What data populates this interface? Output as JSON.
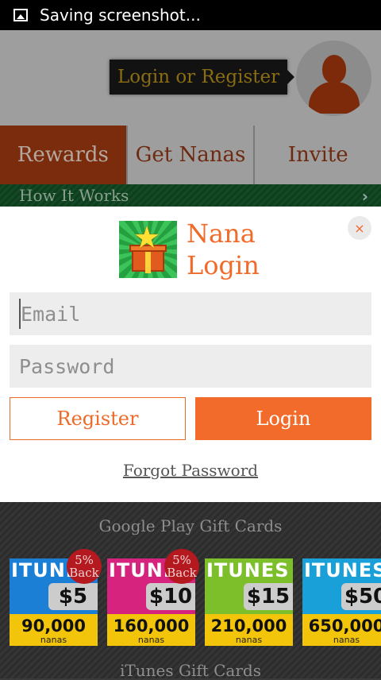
{
  "status_bar": {
    "text": "Saving screenshot...",
    "icon": "image-icon"
  },
  "header": {
    "login_tip": "Login or Register",
    "avatar_icon": "user-icon"
  },
  "tabs": [
    {
      "label": "Rewards",
      "active": true
    },
    {
      "label": "Get Nanas",
      "active": false
    },
    {
      "label": "Invite",
      "active": false
    }
  ],
  "how_it_works": {
    "label": "How It Works"
  },
  "login_modal": {
    "title_line1": "Nana",
    "title_line2": "Login",
    "close_symbol": "×",
    "email_placeholder": "Email",
    "password_placeholder": "Password",
    "register_label": "Register",
    "login_label": "Login",
    "forgot_label": "Forgot Password"
  },
  "sections": {
    "google_play": "Google Play Gift Cards",
    "itunes": "iTunes Gift Cards"
  },
  "cards": [
    {
      "brand": "ITUNES",
      "amount": "$5",
      "nanas": "90,000",
      "unit": "nanas",
      "badge_line1": "5%",
      "badge_line2": "Back",
      "color": "#1c7fd6"
    },
    {
      "brand": "ITUNES",
      "amount": "$10",
      "nanas": "160,000",
      "unit": "nanas",
      "badge_line1": "5%",
      "badge_line2": "Back",
      "color": "#d6247e"
    },
    {
      "brand": "ITUNES",
      "amount": "$15",
      "nanas": "210,000",
      "unit": "nanas",
      "color": "#7cbf2a"
    },
    {
      "brand": "ITUNES",
      "amount": "$50",
      "nanas": "650,000",
      "unit": "nanas",
      "color": "#1aa0d8"
    }
  ],
  "colors": {
    "accent": "#f26b2a",
    "dark_accent": "#7a2c0d",
    "card_yellow": "#f2c40a"
  }
}
